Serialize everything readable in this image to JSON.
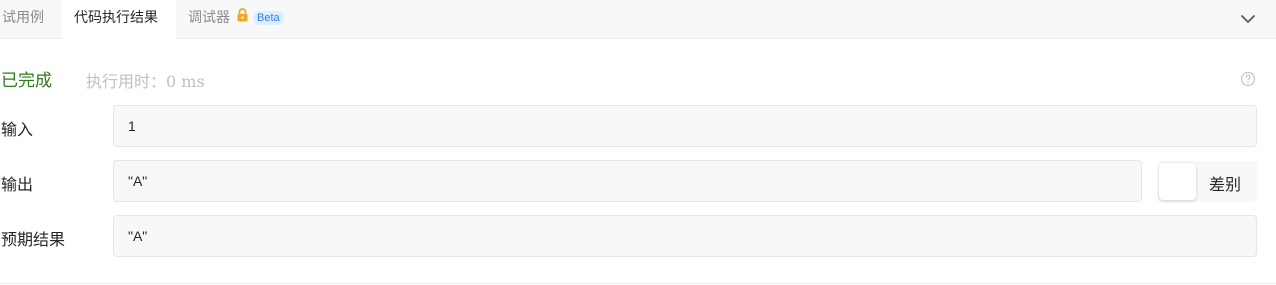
{
  "tabs": [
    {
      "label": "试用例"
    },
    {
      "label": "代码执行结果"
    },
    {
      "label": "调试器",
      "badge": "Beta"
    }
  ],
  "result": {
    "status": "已完成",
    "runtime": "执行用时：0 ms"
  },
  "rows": {
    "input": {
      "label": "输入",
      "value": "1"
    },
    "output": {
      "label": "输出",
      "value": "\"A\""
    },
    "expected": {
      "label": "预期结果",
      "value": "\"A\""
    }
  },
  "diff": {
    "label": "差别"
  },
  "colors": {
    "accent_success": "#2f7b18",
    "beta_text": "#2f80ed",
    "lock": "#f5a623"
  }
}
